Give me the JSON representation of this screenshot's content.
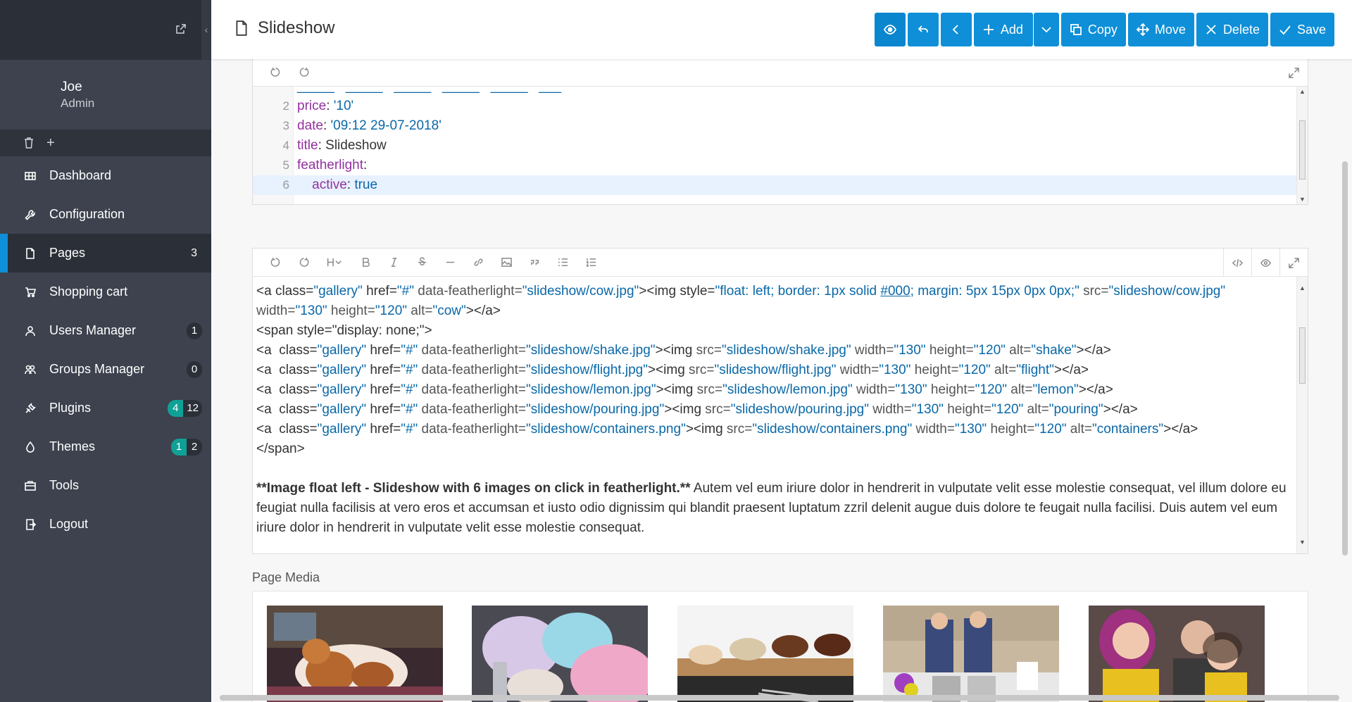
{
  "sidebar": {
    "user_name": "Joe",
    "user_role": "Admin",
    "collapse_glyph": "‹",
    "quick_add": "+",
    "items": [
      {
        "label": "Dashboard",
        "icon": "dashboard-icon"
      },
      {
        "label": "Configuration",
        "icon": "wrench-icon"
      },
      {
        "label": "Pages",
        "icon": "file-icon",
        "count": "3"
      },
      {
        "label": "Shopping cart",
        "icon": "cart-icon"
      },
      {
        "label": "Users Manager",
        "icon": "user-icon",
        "badge": "1"
      },
      {
        "label": "Groups Manager",
        "icon": "users-icon",
        "badge": "0"
      },
      {
        "label": "Plugins",
        "icon": "plug-icon",
        "badge_updates": "4",
        "badge_total": "12"
      },
      {
        "label": "Themes",
        "icon": "tint-icon",
        "badge_updates": "1",
        "badge_total": "2"
      },
      {
        "label": "Tools",
        "icon": "briefcase-icon"
      },
      {
        "label": "Logout",
        "icon": "logout-icon"
      }
    ]
  },
  "header": {
    "title": "Slideshow",
    "add_label": "Add",
    "copy_label": "Copy",
    "move_label": "Move",
    "delete_label": "Delete",
    "save_label": "Save"
  },
  "yaml_editor": {
    "lines": [
      {
        "n": "",
        "key": "",
        "val": ""
      },
      {
        "n": "2",
        "key": "price",
        "val": "'10'"
      },
      {
        "n": "3",
        "key": "date",
        "val": "'09:12 29-07-2018'"
      },
      {
        "n": "4",
        "key": "title",
        "val": "Slideshow"
      },
      {
        "n": "5",
        "key": "featherlight",
        "val": ""
      },
      {
        "n": "6",
        "key": "active",
        "val": "true"
      }
    ]
  },
  "markdown_editor": {
    "line1_a": "<a  class=",
    "line1_b": "\"gallery\"",
    "line1_c": " href=",
    "line1_d": "\"#\"",
    "line1_e": " data-featherlight=",
    "line1_f": "\"slideshow/cow.jpg\"",
    "line1_g": "><img style=",
    "line1_h": "\"float: left; border: 1px solid ",
    "line1_i": "#000",
    "line1_j": "; margin: 5px 15px 0px 0px;\"",
    "line1_k": " src=",
    "line1_l": "\"slideshow/cow.jpg\"",
    "line2_a": "width=",
    "line2_b": "\"130\"",
    "line2_c": " height=",
    "line2_d": "\"120\"",
    "line2_e": " alt=",
    "line2_f": "\"cow\"",
    "line2_g": "></a>",
    "span_open": "<span style=\"display: none;\">",
    "gallery_rows": [
      {
        "img": "slideshow/shake.jpg",
        "alt": "shake"
      },
      {
        "img": "slideshow/flight.jpg",
        "alt": "flight"
      },
      {
        "img": "slideshow/lemon.jpg",
        "alt": "lemon"
      },
      {
        "img": "slideshow/pouring.jpg",
        "alt": "pouring"
      },
      {
        "img": "slideshow/containers.png",
        "alt": "containers"
      }
    ],
    "span_close": "</span>",
    "para_bold": "**Image float left - Slideshow with 6 images on click in featherlight.**",
    "para_text": "  Autem vel eum iriure dolor in hendrerit in vulputate velit esse molestie consequat, vel illum dolore eu feugiat nulla facilisis at vero eros et accumsan et iusto odio dignissim qui blandit praesent luptatum zzril delenit augue duis dolore te feugait nulla facilisi. Duis autem vel eum iriure dolor in hendrerit in vulputate velit esse molestie consequat."
  },
  "page_media": {
    "title": "Page Media",
    "images": [
      "cow",
      "shake",
      "ice cream",
      "containers",
      "family"
    ]
  },
  "colors": {
    "accent": "#0e8fd8",
    "sidebar_bg": "#3d424e",
    "sidebar_dark": "#2b2f37",
    "badge_teal": "#10a196"
  }
}
